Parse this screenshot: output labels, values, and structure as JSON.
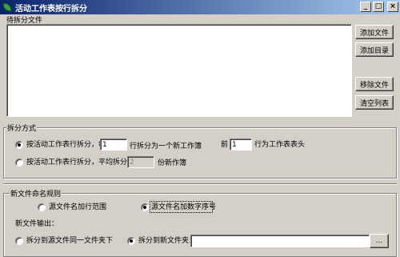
{
  "window": {
    "title": "活动工作表按行拆分",
    "controls": {
      "minimize": "_",
      "maximize": "□",
      "close": "×"
    }
  },
  "files_section": {
    "label": "待拆分文件",
    "buttons": {
      "add_file": "添加文件",
      "add_dir": "添加目录",
      "remove_file": "移除文件",
      "clear_list": "清空列表"
    }
  },
  "split_mode": {
    "label": "拆分方式",
    "option_by_rows": {
      "prefix": "按活动工作表行拆分，每",
      "rows_value": "1",
      "suffix": "行拆分为一个新工作簿",
      "header_prefix": "前",
      "header_value": "1",
      "header_suffix": "行为工作表表头",
      "selected": true
    },
    "option_even": {
      "prefix": "按活动工作表行拆分，平均拆分为",
      "count_value": "2",
      "suffix": "份新作簿",
      "selected": false
    }
  },
  "naming": {
    "label": "新文件命名规则",
    "option_range": {
      "label": "源文件名加行范围",
      "selected": false
    },
    "option_index": {
      "label": "源文件名加数字序号",
      "selected": true
    }
  },
  "output": {
    "label": "新文件输出：",
    "option_same": {
      "label": "拆分到源文件同一文件夹下",
      "selected": false
    },
    "option_new": {
      "label": "拆分到新文件夹：",
      "selected": true
    },
    "folder_value": "",
    "browse_label": "..."
  }
}
